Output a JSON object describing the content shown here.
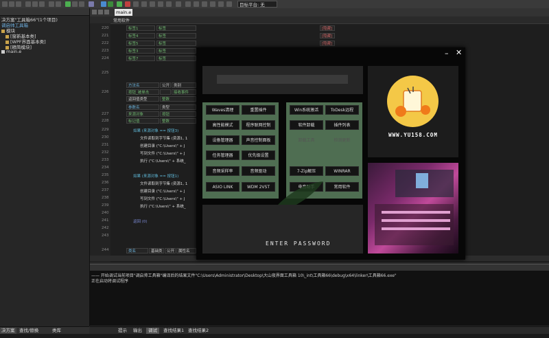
{
  "toolbar": {
    "platform_label": "目标平台: 无"
  },
  "left_panel": {
    "title": "决方案\"工具箱66\"(1个项目)",
    "project": "调启帅工具箱",
    "tree": [
      "模块",
      "[窗新基本类]",
      "[WPF界面基本类]",
      "[精简模块]",
      "main.e"
    ],
    "tabs": [
      "决方案",
      "查找/替换",
      "类库"
    ]
  },
  "editor": {
    "file_tab": "main.e",
    "sub_header": "常用软件",
    "top_rows": [
      {
        "ln": "220",
        "name": "标签1",
        "val": "标签",
        "attr": "[隐藏]"
      },
      {
        "ln": "221",
        "name": "标签4",
        "val": "标签",
        "attr": "[隐藏]"
      },
      {
        "ln": "222",
        "name": "标签5",
        "val": "标签",
        "attr": "[隐藏]"
      },
      {
        "ln": "223",
        "name": "标签3",
        "val": "标签",
        "attr": "[隐藏]"
      },
      {
        "ln": "224",
        "name": "标签7",
        "val": "标签",
        "attr": "[隐藏]"
      }
    ],
    "line_numbers": [
      "225",
      "226",
      "227",
      "228",
      "229",
      "230",
      "231",
      "232",
      "233",
      "234",
      "235",
      "236",
      "237",
      "238",
      "239",
      "240",
      "241",
      "242",
      "243",
      "244"
    ],
    "method_table": {
      "header": [
        "方法名",
        "公开",
        "类别"
      ],
      "row": [
        "按钮_被单击",
        "",
        "接收事件"
      ],
      "ret_label": "返回值类型",
      "ret_val": "整数"
    },
    "param_table": {
      "header": [
        "参数名",
        "类型"
      ],
      "rows": [
        [
          "来源对象",
          "按钮"
        ],
        [
          "标记值",
          "整数"
        ]
      ]
    },
    "code_lines": [
      "如果 (来源对象 == 按钮3)",
      "文件读取到字节集 (资源1, 1",
      "创建目录 (\"C:\\Users\\\" + J",
      "写到文件 (\"C:\\Users\\\" + J",
      "执行 (\"C:\\Users\\\" + 系统_",
      "如果 (来源对象 == 按钮1)",
      "文件读取到字节集 (资源1, 1",
      "创建目录 (\"C:\\Users\\\" + J",
      "写到文件 (\"C:\\Users\\\" + J",
      "执行 (\"C:\\Users\\\" + 系统_",
      "返回 (0)"
    ],
    "bottom_table": [
      "类名",
      "基础类",
      "公开",
      "属性名"
    ]
  },
  "output": {
    "lines": [
      "—— 开始调试当前项目\"调启帅工具箱\"编译后的结果文件\"C:\\Users\\Administrator\\Desktop\\大山夜界面工具箱 10\\_int\\工具箱66\\debug\\x64\\linker\\工具箱66.exe\"",
      "正在启动将调试程序"
    ],
    "tabs": [
      "提示",
      "输出",
      "调试",
      "查找结果1",
      "查找结果2"
    ]
  },
  "overlay": {
    "left_group": [
      "Waves清理",
      "重置插件",
      "高性能模式",
      "程序联网控制",
      "设备管理器",
      "声音控制面板",
      "任务管理器",
      "优先级设置",
      "音频采样率",
      "音频驱动",
      "ASIO LINK",
      "WDM 2VST"
    ],
    "right_group": [
      "Win系统激活",
      "ToDesk远程",
      "软件卸载",
      "插件列表",
      "",
      "",
      "7-Zip解压",
      "WINRAR",
      "电音助手",
      "常用软件"
    ],
    "dim_buttons": [
      "卸载工具",
      "检测更新"
    ],
    "password_label": "ENTER PASSWORD",
    "logo_text": "WWW.YU158.COM",
    "colors": {
      "group_bg": "#4f6e52",
      "logo_yellow": "#f4c847"
    }
  }
}
